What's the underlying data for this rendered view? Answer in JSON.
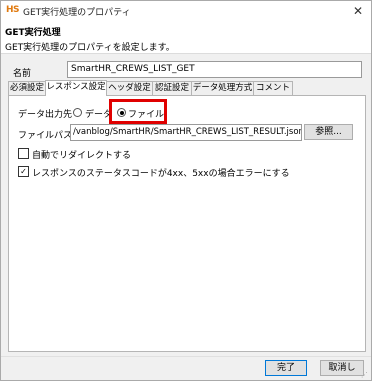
{
  "window": {
    "logo": "HS",
    "title": "GET実行処理のプロパティ",
    "close_glyph": "✕"
  },
  "header": {
    "title": "GET実行処理",
    "description": "GET実行処理のプロパティを設定します。"
  },
  "name_field": {
    "label": "名前",
    "value": "SmartHR_CREWS_LIST_GET"
  },
  "tabs": [
    {
      "label": "必須設定",
      "active": false
    },
    {
      "label": "レスポンス設定",
      "active": true
    },
    {
      "label": "ヘッダ設定",
      "active": false
    },
    {
      "label": "認証設定",
      "active": false
    },
    {
      "label": "データ処理方式",
      "active": false
    },
    {
      "label": "コメント",
      "active": false
    }
  ],
  "response": {
    "output_label": "データ出力先",
    "option_data": "データ",
    "option_file": "ファイル",
    "selected": "ファイル",
    "filepath_label": "ファイルパス",
    "filepath_value": "/vanblog/SmartHR/SmartHR_CREWS_LIST_RESULT.json",
    "browse_button": "参照...",
    "auto_redirect_label": "自動でリダイレクトする",
    "auto_redirect_checked": false,
    "error_on_status_label": "レスポンスのステータスコードが4xx、5xxの場合エラーにする",
    "error_on_status_checked": true
  },
  "footer": {
    "ok_button": "完了",
    "cancel_button": "取消し"
  },
  "colors": {
    "highlight": "#e00000",
    "logo": "#e07a10"
  }
}
